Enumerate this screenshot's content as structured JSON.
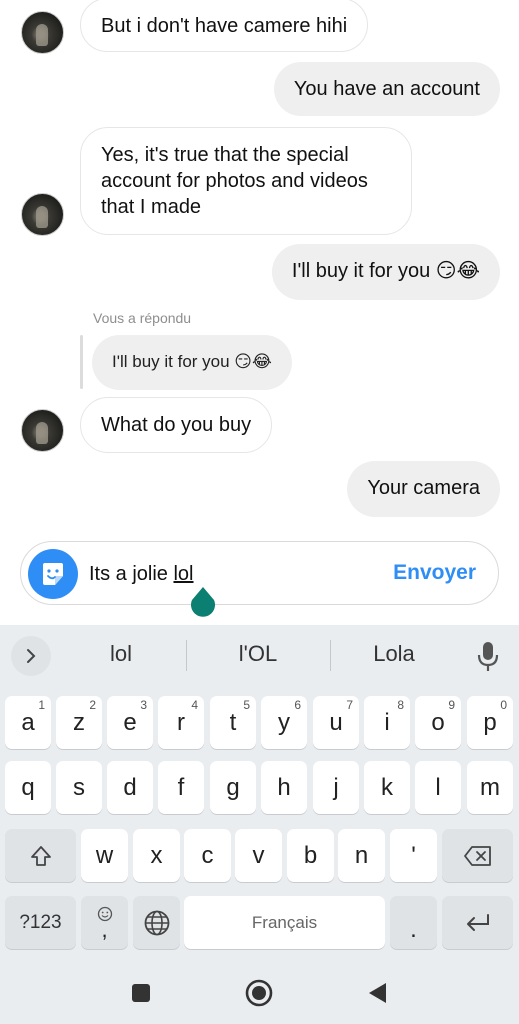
{
  "messages": {
    "m1": "But i don't have camere hihi",
    "m2": "You have an account",
    "m3_line1": "Yes, it's true that the special",
    "m3_line2": "account for photos and videos",
    "m3_line3": "that I made",
    "m4": "I'll buy it for you 😏😂",
    "reply_label": "Vous a répondu",
    "reply_quote": "I'll buy it for you 😏😂",
    "m5": "What do you buy",
    "m6": "Your camera"
  },
  "composer": {
    "text_prefix": "Its a jolie ",
    "text_current_word": "lol",
    "send_label": "Envoyer"
  },
  "keyboard": {
    "suggestions": [
      "lol",
      "l'OL",
      "Lola"
    ],
    "row1": [
      {
        "k": "a",
        "h": "1"
      },
      {
        "k": "z",
        "h": "2"
      },
      {
        "k": "e",
        "h": "3"
      },
      {
        "k": "r",
        "h": "4"
      },
      {
        "k": "t",
        "h": "5"
      },
      {
        "k": "y",
        "h": "6"
      },
      {
        "k": "u",
        "h": "7"
      },
      {
        "k": "i",
        "h": "8"
      },
      {
        "k": "o",
        "h": "9"
      },
      {
        "k": "p",
        "h": "0"
      }
    ],
    "row2": [
      "q",
      "s",
      "d",
      "f",
      "g",
      "h",
      "j",
      "k",
      "l",
      "m"
    ],
    "row3": [
      "w",
      "x",
      "c",
      "v",
      "b",
      "n",
      "'"
    ],
    "symbols_label": "?123",
    "comma_label": ",",
    "space_label": "Français",
    "period_label": "."
  },
  "colors": {
    "accent": "#2f8ef5",
    "cursor_handle": "#0b7f72",
    "sent_bubble": "#efefef",
    "keyboard_bg": "#e9edf0"
  }
}
